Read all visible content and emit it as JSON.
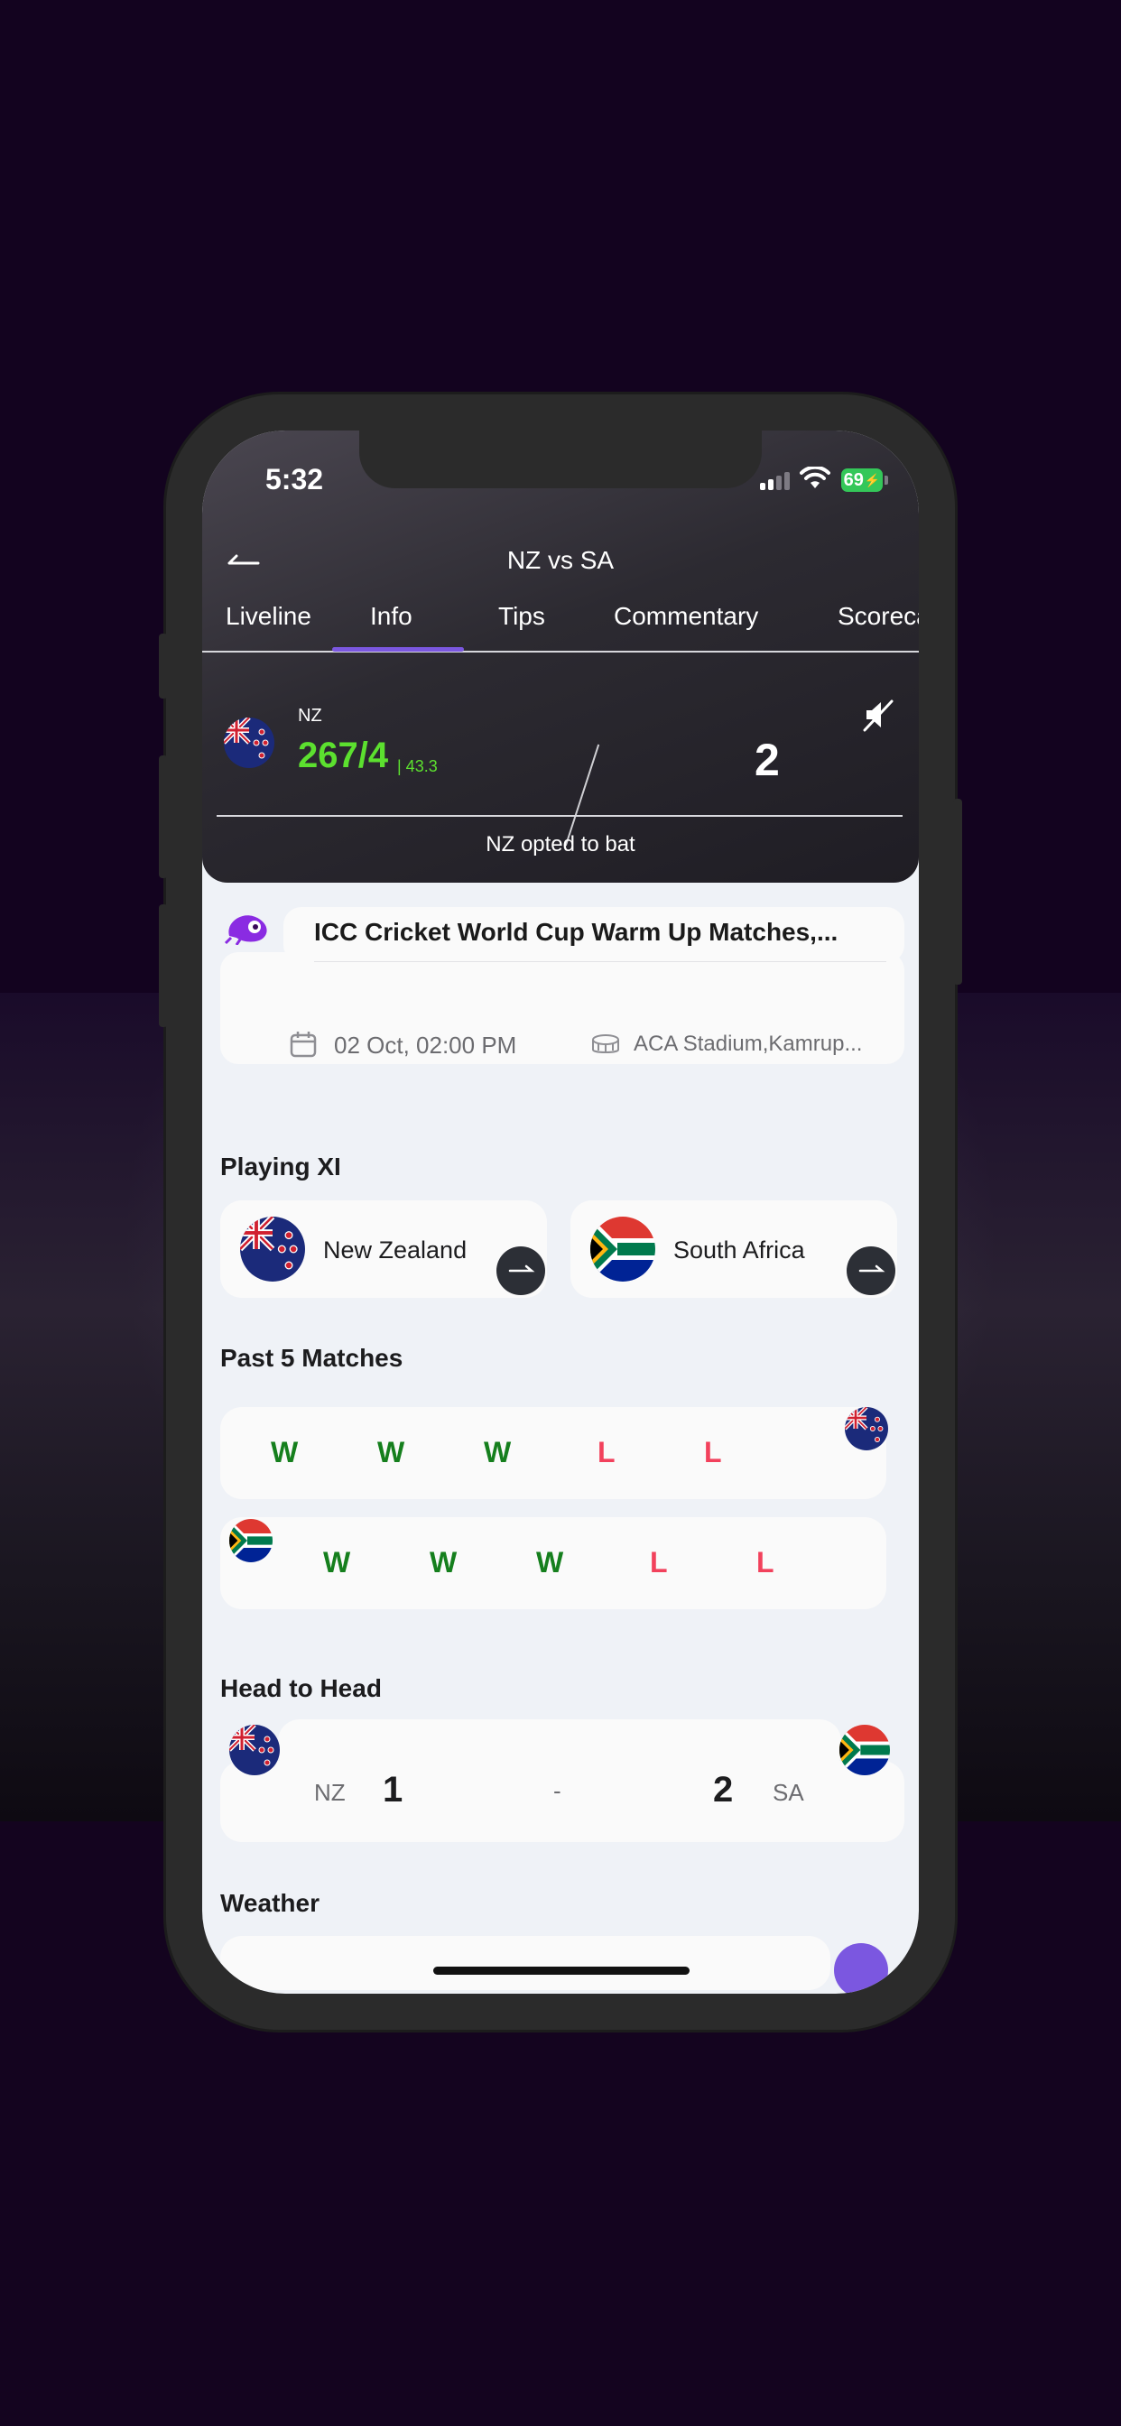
{
  "status_bar": {
    "time": "5:32",
    "battery": "69"
  },
  "header": {
    "title": "NZ vs SA"
  },
  "tabs": [
    {
      "label": "Liveline"
    },
    {
      "label": "Info"
    },
    {
      "label": "Tips"
    },
    {
      "label": "Commentary"
    },
    {
      "label": "Scorecard"
    }
  ],
  "active_tab": "Info",
  "live": {
    "team": "NZ",
    "score": "267/4",
    "overs": "| 43.3",
    "right_value": "2",
    "toss": "NZ opted to bat"
  },
  "match": {
    "title": "ICC Cricket World Cup Warm Up Matches,...",
    "date": "02 Oct, 02:00 PM",
    "venue": "ACA Stadium,Kamrup..."
  },
  "playing_xi": {
    "heading": "Playing XI",
    "teams": [
      {
        "name": "New Zealand"
      },
      {
        "name": "South Africa"
      }
    ]
  },
  "past_matches": {
    "heading": "Past 5 Matches",
    "nz": [
      "W",
      "W",
      "W",
      "L",
      "L"
    ],
    "sa": [
      "W",
      "W",
      "W",
      "L",
      "L"
    ]
  },
  "head_to_head": {
    "heading": "Head to Head",
    "left_team": "NZ",
    "left_score": "1",
    "separator": "-",
    "right_team": "SA",
    "right_score": "2"
  },
  "weather": {
    "heading": "Weather"
  },
  "colors": {
    "accent": "#7b57e0",
    "win": "#157f1d",
    "loss": "#f2415c",
    "score_green": "#5ce02f"
  }
}
